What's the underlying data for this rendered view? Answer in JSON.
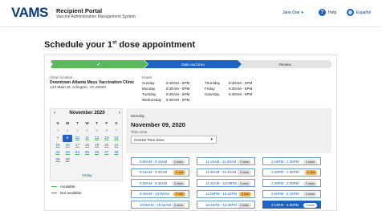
{
  "header": {
    "logo": "VAMS",
    "title": "Recipient Portal",
    "subtitle": "Vaccine Administration Management System",
    "user": "Jane Doe",
    "help": "Help",
    "language": "Español"
  },
  "page": {
    "title_pre": "Schedule your 1",
    "title_sup": "st",
    "title_post": " dose appointment"
  },
  "steps": [
    {
      "label": "",
      "state": "complete"
    },
    {
      "label": "Date and time",
      "state": "current"
    },
    {
      "label": "Review",
      "state": "upcoming"
    }
  ],
  "clinic": {
    "label": "Clinic location",
    "name": "Downtown Atlanta Mass Vaccination Clinic",
    "address": "123 Main St, Arlington, VA 22022"
  },
  "hours": {
    "label": "Hours",
    "rows": [
      {
        "day": "Sunday",
        "time": "8:30AM - 5PM"
      },
      {
        "day": "Monday",
        "time": "8:30AM - 5PM"
      },
      {
        "day": "Tuesday",
        "time": "8:30AM - 5PM"
      },
      {
        "day": "Wednesday",
        "time": "8:30AM - 5PM"
      },
      {
        "day": "Thursday",
        "time": "8:30AM - 5PM"
      },
      {
        "day": "Friday",
        "time": "8:30AM - 5PM"
      },
      {
        "day": "Saturday",
        "time": "8:30AM - 5PM"
      }
    ]
  },
  "calendar": {
    "month": "November 2020",
    "dow": [
      "S",
      "M",
      "T",
      "W",
      "T",
      "F",
      "S"
    ],
    "days": [
      {
        "d": "1",
        "s": "na"
      },
      {
        "d": "2",
        "s": "na"
      },
      {
        "d": "3",
        "s": "na"
      },
      {
        "d": "4",
        "s": "na"
      },
      {
        "d": "5",
        "s": "na"
      },
      {
        "d": "6",
        "s": "na"
      },
      {
        "d": "7",
        "s": "na"
      },
      {
        "d": "8",
        "s": "na"
      },
      {
        "d": "9",
        "s": "sel"
      },
      {
        "d": "10",
        "s": "av"
      },
      {
        "d": "11",
        "s": "av"
      },
      {
        "d": "12",
        "s": "av"
      },
      {
        "d": "13",
        "s": "av"
      },
      {
        "d": "14",
        "s": "av"
      },
      {
        "d": "15",
        "s": "av"
      },
      {
        "d": "16",
        "s": "av"
      },
      {
        "d": "17",
        "s": "av"
      },
      {
        "d": "18",
        "s": "av"
      },
      {
        "d": "19",
        "s": "av"
      },
      {
        "d": "20",
        "s": "av"
      },
      {
        "d": "21",
        "s": "av"
      },
      {
        "d": "22",
        "s": "av"
      },
      {
        "d": "23",
        "s": "av"
      },
      {
        "d": "24",
        "s": "av"
      },
      {
        "d": "25",
        "s": "av"
      },
      {
        "d": "26",
        "s": "av"
      },
      {
        "d": "27",
        "s": "av"
      },
      {
        "d": "28",
        "s": "av"
      },
      {
        "d": "29",
        "s": "av"
      },
      {
        "d": "30",
        "s": "av"
      },
      {
        "d": "",
        "s": ""
      },
      {
        "d": "",
        "s": ""
      },
      {
        "d": "",
        "s": ""
      },
      {
        "d": "",
        "s": ""
      },
      {
        "d": "",
        "s": ""
      }
    ],
    "today": "Today"
  },
  "legend": {
    "available": "Available",
    "not_available": "Not available"
  },
  "selected": {
    "weekday": "Monday",
    "date": "November 09, 2020",
    "tz_label": "Time zone",
    "tz_value": "Central Time Zone"
  },
  "slots": [
    {
      "time": "9:00AM - 9:15AM",
      "tag": "2 slots",
      "kind": "g"
    },
    {
      "time": "9:15AM - 9:30AM",
      "tag": "1 slot",
      "kind": "o"
    },
    {
      "time": "9:30AM - 9:45AM",
      "tag": "2 slots",
      "kind": "g"
    },
    {
      "time": "9:45AM - 10:00AM",
      "tag": "1 slot",
      "kind": "o"
    },
    {
      "time": "10:00AM - 10:15AM",
      "tag": "2 slots",
      "kind": "g"
    },
    {
      "time": "11:15AM - 11:30AM",
      "tag": "2 slots",
      "kind": "g"
    },
    {
      "time": "11:30AM - 11:45AM",
      "tag": "2 slots",
      "kind": "g"
    },
    {
      "time": "11:45AM - 12:00PM",
      "tag": "2 slots",
      "kind": "g"
    },
    {
      "time": "12:00PM - 12:15PM",
      "tag": "1 slot",
      "kind": "o"
    },
    {
      "time": "12:15PM - 12:30PM",
      "tag": "2 slots",
      "kind": "g"
    },
    {
      "time": "1:15PM - 1:30PM",
      "tag": "2 slots",
      "kind": "g"
    },
    {
      "time": "1:30PM - 1:45PM",
      "tag": "1 slot",
      "kind": "o"
    },
    {
      "time": "1:45PM - 2:00PM",
      "tag": "2 slots",
      "kind": "g"
    },
    {
      "time": "2:00PM - 2:15PM",
      "tag": "2 slots",
      "kind": "g"
    },
    {
      "time": "2:15PM - 2:30PM",
      "tag": "2 slots",
      "kind": "sel"
    }
  ]
}
